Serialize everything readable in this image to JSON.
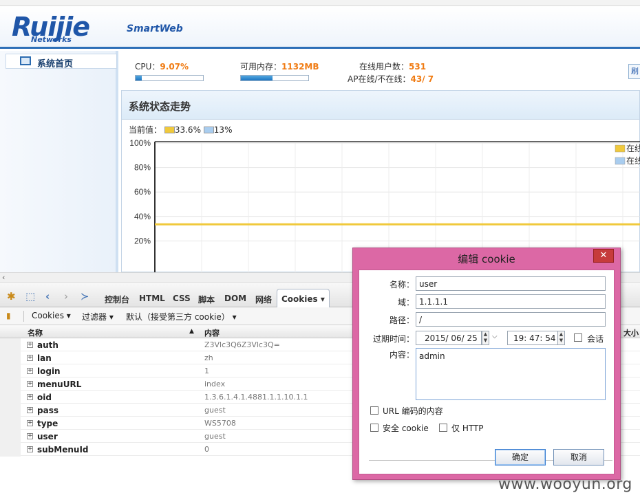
{
  "header": {
    "logo": "Ruijie",
    "logo_sub": "Networks",
    "product": "SmartWeb"
  },
  "sidebar": {
    "items": [
      {
        "label": "系统首页"
      }
    ]
  },
  "stats": {
    "cpu_label": "CPU：",
    "cpu_value": "9.07%",
    "cpu_fraction": 0.0907,
    "mem_label": "可用内存：",
    "mem_value": "1132MB",
    "mem_fraction": 0.47,
    "users_label": "在线用户数：",
    "users_value": "531",
    "ap_label": "AP在线/不在线：",
    "ap_value": "43/ 7",
    "side_button": "刷"
  },
  "panel": {
    "title": "系统状态走势",
    "current_label": "当前值：",
    "current_a": "33.6%",
    "current_b": "13%",
    "colors": {
      "series_a": "#f0c93c",
      "series_b": "#a9cdef"
    }
  },
  "chart_data": {
    "type": "line",
    "yticks": [
      "100%",
      "80%",
      "60%",
      "40%",
      "20%"
    ],
    "ylim": [
      0,
      100
    ],
    "grid": true,
    "legend_position": "top-right",
    "series": [
      {
        "name": "在线",
        "values": [
          33.6,
          33.6,
          33.6,
          33.6,
          33.6,
          33.6,
          33.6,
          33.6,
          33.6,
          33.6,
          33.6
        ],
        "color": "#f0c93c"
      },
      {
        "name": "在线",
        "values": [],
        "color": "#a9cdef"
      }
    ]
  },
  "firebug": {
    "tabs": [
      "控制台",
      "HTML",
      "CSS",
      "脚本",
      "DOM",
      "网络",
      "Cookies ▾"
    ],
    "sub": {
      "cookies": "Cookies ▾",
      "filter": "过滤器 ▾",
      "default": "默认（接受第三方 cookie） ▾"
    },
    "columns": {
      "name": "名称",
      "content": "内容",
      "size": "大小"
    },
    "rows": [
      {
        "name": "auth",
        "value": "Z3Vlc3Q6Z3Vlc3Q="
      },
      {
        "name": "lan",
        "value": "zh"
      },
      {
        "name": "login",
        "value": "1"
      },
      {
        "name": "menuURL",
        "value": "index"
      },
      {
        "name": "oid",
        "value": "1.3.6.1.4.1.4881.1.1.10.1.1"
      },
      {
        "name": "pass",
        "value": "guest"
      },
      {
        "name": "type",
        "value": "WS5708"
      },
      {
        "name": "user",
        "value": "guest"
      },
      {
        "name": "subMenuId",
        "value": "0"
      }
    ]
  },
  "dialog": {
    "title": "编辑 cookie",
    "close": "✕",
    "name_label": "名称：",
    "name_value": "user",
    "domain_label": "域：",
    "domain_value": "1.1.1.1",
    "path_label": "路径：",
    "path_value": "/",
    "expire_label": "过期时间：",
    "expire_date": "2015/ 06/ 25",
    "expire_time": "19: 47: 54",
    "session_label": "会话",
    "content_label": "内容：",
    "content_value": "admin",
    "url_encode_label": "URL 编码的内容",
    "secure_label": "安全 cookie",
    "http_only_label": "仅 HTTP",
    "ok": "确定",
    "cancel": "取消"
  },
  "watermark": "www.wooyun.org"
}
